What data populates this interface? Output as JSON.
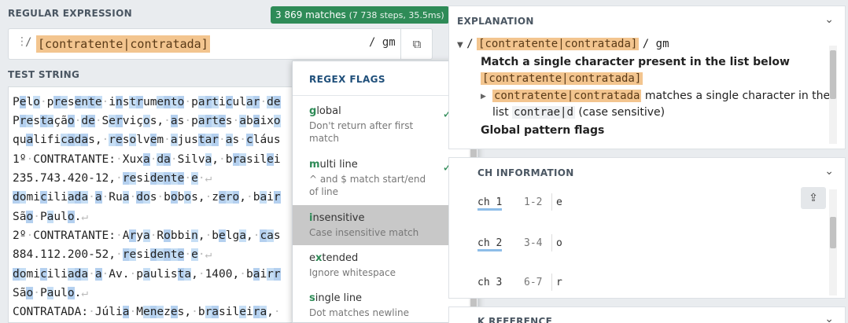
{
  "regex": {
    "header": "REGULAR EXPRESSION",
    "matches_main": "3 869 matches",
    "matches_sub": "(7 738 steps, 35.5ms)",
    "drag_icon": "⋮",
    "delimiter": "/",
    "pattern": "[contratente|contratada]",
    "flags": "/ gm",
    "copy_icon": "⧉"
  },
  "test_string": {
    "header": "TEST STRING",
    "lines": [
      "Pelo·presente·instrumento·particular·de",
      "Prestação·de·Serviços,·as·partes·abaixo",
      "qualificadas,·resolvem·ajustar·as·cláus",
      "1º·CONTRATANTE:·Xuxa·da·Silva,·brasilei",
      "235.743.420-12,·residente·e·↵",
      "domiciliada·a·Rua·dos·bobos,·zero,·bair",
      "São·Paulo.↵",
      "2º·CONTRATANTE:·Arya·Robbin,·belga,·cas",
      "884.112.200-52,·residente·e·↵",
      "domiciliada·a·Av.·paulista,·1400,·bairr",
      "São·Paulo.↵",
      "CONTRATADA:·Júlia·Menezes,·brasileira,·"
    ]
  },
  "flags_menu": {
    "title": "REGEX FLAGS",
    "items": [
      {
        "key": "g",
        "rest": "lobal",
        "desc": "Don't return after first match",
        "checked": "✓"
      },
      {
        "key": "m",
        "rest": "ulti line",
        "desc": "^ and $ match start/end of line",
        "checked": "✓"
      },
      {
        "key": "i",
        "rest": "nsensitive",
        "desc": "Case insensitive match",
        "checked": ""
      },
      {
        "key": "x",
        "prefix": "e",
        "rest": "tended",
        "desc": "Ignore whitespace",
        "checked": ""
      },
      {
        "key": "s",
        "rest": "ingle line",
        "desc": "Dot matches newline",
        "checked": ""
      }
    ]
  },
  "explanation": {
    "title": "EXPLANATION",
    "chevron": "⌄",
    "line1_delim": "/",
    "line1_pattern": "[contratente|contratada]",
    "line1_flags": "/ gm",
    "line2": "Match a single character present in the list below",
    "line3_pattern": "[contratente|contratada]",
    "line4_code": "contratente|contratada",
    "line4_text": " matches a single character in the",
    "line5_pre": "list ",
    "line5_code": "contrae|d",
    "line5_post": " (case sensitive)",
    "line6": "Global pattern flags"
  },
  "match_info": {
    "title": "CH INFORMATION",
    "chevron": "⌄",
    "share_icon": "⇪",
    "rows": [
      {
        "label": "ch 1",
        "range": "1-2",
        "value": "e"
      },
      {
        "label": "ch 2",
        "range": "3-4",
        "value": "o"
      },
      {
        "label": "ch 3",
        "range": "6-7",
        "value": "r"
      }
    ]
  },
  "quick_ref": {
    "title": "K REFERENCE",
    "chevron": "⌄"
  }
}
